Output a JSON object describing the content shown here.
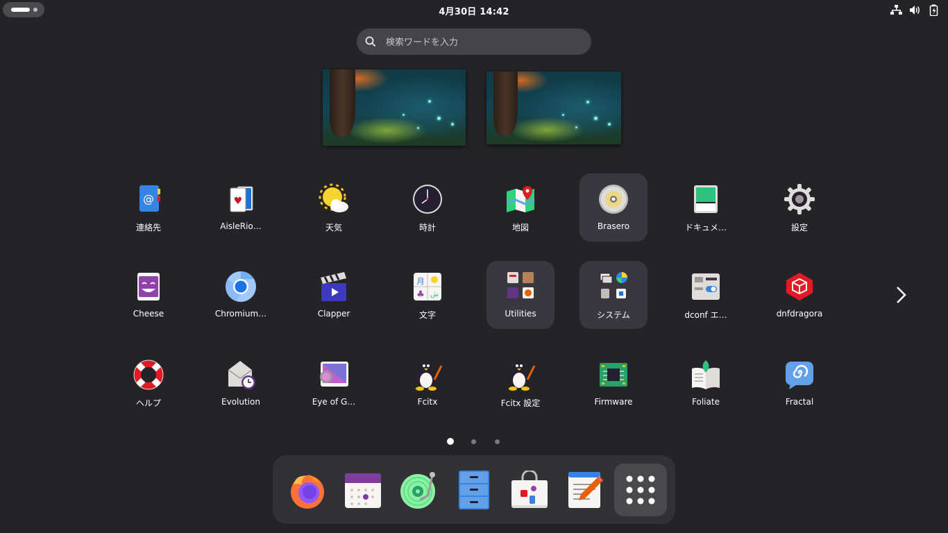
{
  "topbar": {
    "clock": "4月30日 14:42",
    "tray_icons": [
      "network-icon",
      "volume-icon",
      "battery-icon"
    ]
  },
  "search": {
    "placeholder": "検索ワードを入力"
  },
  "apps": [
    {
      "label": "連絡先",
      "icon": "contacts-icon"
    },
    {
      "label": "AisleRio…",
      "icon": "cards-icon"
    },
    {
      "label": "天気",
      "icon": "weather-icon"
    },
    {
      "label": "時計",
      "icon": "clock-icon"
    },
    {
      "label": "地図",
      "icon": "maps-icon"
    },
    {
      "label": "Brasero",
      "icon": "disc-icon"
    },
    {
      "label": "ドキュメ…",
      "icon": "document-scanner-icon"
    },
    {
      "label": "設定",
      "icon": "settings-gear-icon"
    },
    {
      "label": "Cheese",
      "icon": "cheese-icon"
    },
    {
      "label": "Chromium…",
      "icon": "chromium-icon"
    },
    {
      "label": "Clapper",
      "icon": "clapper-icon"
    },
    {
      "label": "文字",
      "icon": "characters-icon"
    },
    {
      "label": "Utilities",
      "icon": "utilities-folder-icon"
    },
    {
      "label": "システム",
      "icon": "system-folder-icon"
    },
    {
      "label": "dconf エ…",
      "icon": "dconf-editor-icon"
    },
    {
      "label": "dnfdragora",
      "icon": "package-icon"
    },
    {
      "label": "ヘルプ",
      "icon": "help-lifebuoy-icon"
    },
    {
      "label": "Evolution",
      "icon": "evolution-icon"
    },
    {
      "label": "Eye of G…",
      "icon": "image-viewer-icon"
    },
    {
      "label": "Fcitx",
      "icon": "tux-icon"
    },
    {
      "label": "Fcitx 設定",
      "icon": "tux-icon"
    },
    {
      "label": "Firmware",
      "icon": "firmware-chip-icon"
    },
    {
      "label": "Foliate",
      "icon": "book-icon"
    },
    {
      "label": "Fractal",
      "icon": "fractal-chat-icon"
    }
  ],
  "pagination": {
    "pages": 3,
    "current": 1
  },
  "dock": [
    {
      "name": "firefox",
      "icon": "firefox-icon"
    },
    {
      "name": "calendar",
      "icon": "calendar-icon"
    },
    {
      "name": "music",
      "icon": "music-player-icon"
    },
    {
      "name": "files",
      "icon": "files-cabinet-icon"
    },
    {
      "name": "software",
      "icon": "software-bag-icon"
    },
    {
      "name": "text-editor",
      "icon": "text-editor-icon"
    },
    {
      "name": "show-apps",
      "icon": "app-grid-icon"
    }
  ],
  "colors": {
    "background": "#242428",
    "highlight": "#38383e",
    "dock": "#323236"
  }
}
